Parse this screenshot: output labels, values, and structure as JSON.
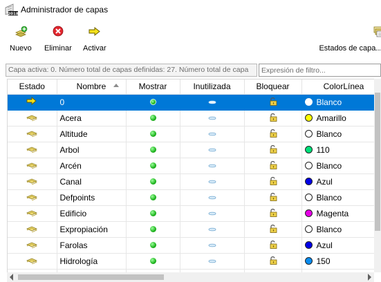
{
  "window": {
    "title": "Administrador de capas",
    "icon": "autocad-2018-icon"
  },
  "toolbar": {
    "new_label": "Nuevo",
    "delete_label": "Eliminar",
    "activate_label": "Activar",
    "states_label": "Estados de capa..."
  },
  "filterbar": {
    "status_text": "Capa activa: 0. Número total de capas definidas: 27. Número total de capa",
    "filter_placeholder": "Expresión de filtro..."
  },
  "columns": [
    "Estado",
    "Nombre",
    "Mostrar",
    "Inutilizada",
    "Bloquear",
    "ColorLínea"
  ],
  "layers": [
    {
      "name": "0",
      "state": "current",
      "on": true,
      "frozen": false,
      "locked": false,
      "color_name": "Blanco",
      "color": "#ffffff",
      "selected": true
    },
    {
      "name": "Acera",
      "state": "layer",
      "on": true,
      "frozen": false,
      "locked": false,
      "color_name": "Amarillo",
      "color": "#ffff00"
    },
    {
      "name": "Altitude",
      "state": "layer",
      "on": true,
      "frozen": false,
      "locked": false,
      "color_name": "Blanco",
      "color": "#ffffff"
    },
    {
      "name": "Arbol",
      "state": "layer",
      "on": true,
      "frozen": false,
      "locked": false,
      "color_name": "110",
      "color": "#00e07a"
    },
    {
      "name": "Arcén",
      "state": "layer",
      "on": true,
      "frozen": false,
      "locked": false,
      "color_name": "Blanco",
      "color": "#ffffff"
    },
    {
      "name": "Canal",
      "state": "layer",
      "on": true,
      "frozen": false,
      "locked": false,
      "color_name": "Azul",
      "color": "#0000e6"
    },
    {
      "name": "Defpoints",
      "state": "layer",
      "on": true,
      "frozen": false,
      "locked": false,
      "color_name": "Blanco",
      "color": "#ffffff"
    },
    {
      "name": "Edificio",
      "state": "layer",
      "on": true,
      "frozen": false,
      "locked": false,
      "color_name": "Magenta",
      "color": "#e600e6"
    },
    {
      "name": "Expropiación",
      "state": "layer",
      "on": true,
      "frozen": false,
      "locked": false,
      "color_name": "Blanco",
      "color": "#ffffff"
    },
    {
      "name": "Farolas",
      "state": "layer",
      "on": true,
      "frozen": false,
      "locked": false,
      "color_name": "Azul",
      "color": "#0000e6"
    },
    {
      "name": "Hidrología",
      "state": "layer",
      "on": true,
      "frozen": false,
      "locked": false,
      "color_name": "150",
      "color": "#0a8cf0"
    },
    {
      "name": "",
      "state": "layer",
      "on": true,
      "frozen": false,
      "locked": false,
      "color_name": "",
      "color": "#ffffff",
      "partial": true
    }
  ]
}
